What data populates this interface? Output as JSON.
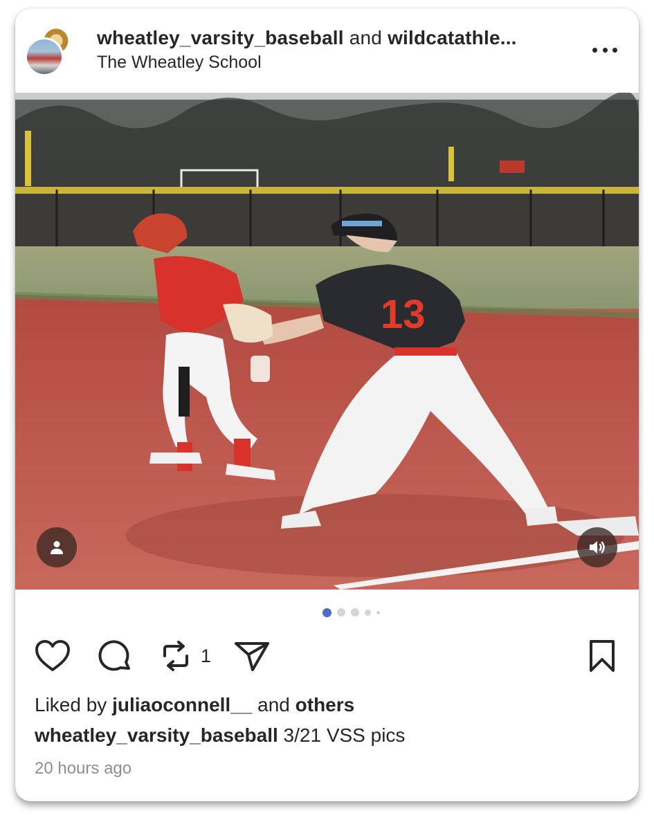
{
  "post": {
    "author_primary": "wheatley_varsity_baseball",
    "joiner": "and",
    "author_secondary": "wildcatathle...",
    "location": "The Wheatley School",
    "image_alt": "Baseball player in red at base with fielder number 13 in black jersey",
    "jersey_number": "13",
    "carousel": {
      "total": 5,
      "active": 0
    },
    "repost_count": "1",
    "likes": {
      "prefix": "Liked by",
      "user": "juliaoconnell__",
      "joiner": "and",
      "suffix": "others"
    },
    "caption": {
      "user": "wheatley_varsity_baseball",
      "text": "3/21 VSS pics"
    },
    "timestamp": "20 hours ago"
  },
  "icons": {
    "more": "more-icon",
    "tag": "person-tag-icon",
    "audio": "speaker-icon",
    "like": "heart-icon",
    "comment": "comment-icon",
    "repost": "repost-icon",
    "share": "paper-plane-icon",
    "save": "bookmark-icon"
  },
  "colors": {
    "active_dot": "#4a6bc9",
    "inactive_dot": "#d5d5d5",
    "text": "#262626",
    "muted": "#8e8e8e"
  }
}
